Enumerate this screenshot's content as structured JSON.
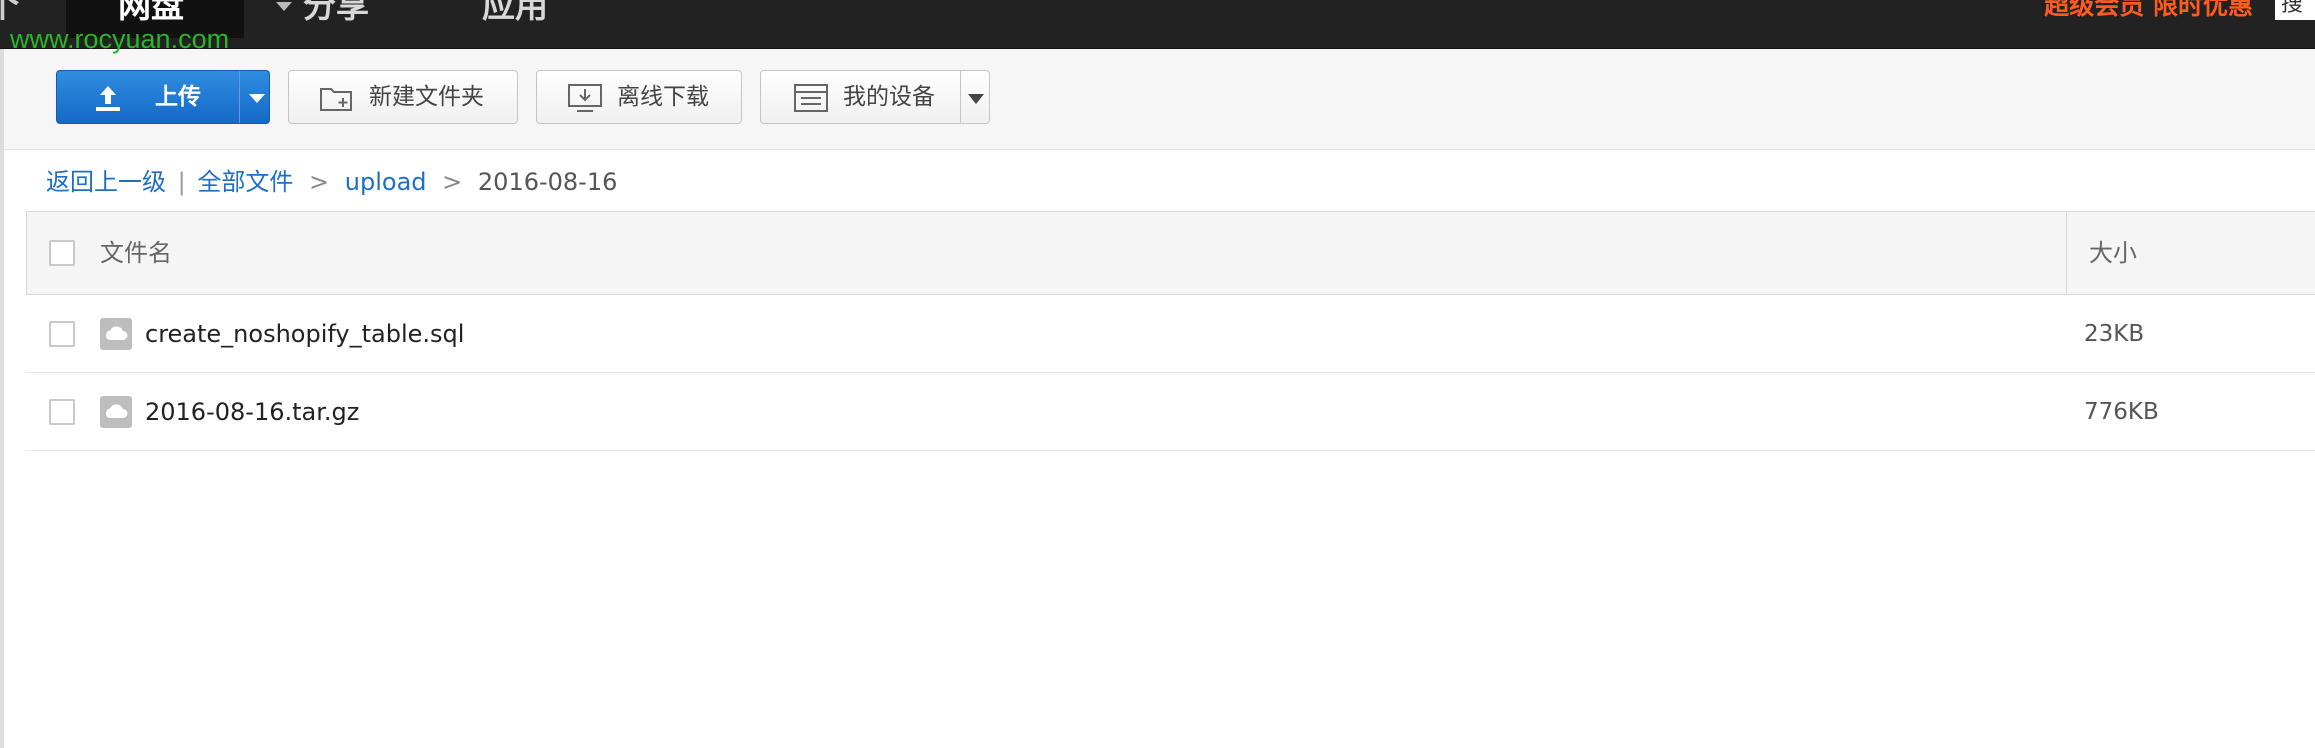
{
  "nav": {
    "edge_label": "个",
    "items": [
      {
        "label": "网盘",
        "active": true
      },
      {
        "label": "分享",
        "active": false
      },
      {
        "label": "应用",
        "active": false
      }
    ],
    "promo": "超级会员 限时优惠",
    "search_stub": "搜"
  },
  "watermark": "www.rocyuan.com",
  "toolbar": {
    "upload_label": "上传",
    "new_folder_label": "新建文件夹",
    "offline_download_label": "离线下载",
    "my_devices_label": "我的设备"
  },
  "breadcrumb": {
    "back": "返回上一级",
    "divider": "|",
    "all_files": "全部文件",
    "sep": ">",
    "folder": "upload",
    "current": "2016-08-16"
  },
  "table": {
    "headers": {
      "name": "文件名",
      "size": "大小"
    },
    "rows": [
      {
        "name": "create_noshopify_table.sql",
        "size": "23KB"
      },
      {
        "name": "2016-08-16.tar.gz",
        "size": "776KB"
      }
    ]
  },
  "colors": {
    "accent": "#1d6fc6",
    "promo": "#ff5a1f",
    "watermark": "#2ab52a",
    "nav_bg": "#222222"
  }
}
